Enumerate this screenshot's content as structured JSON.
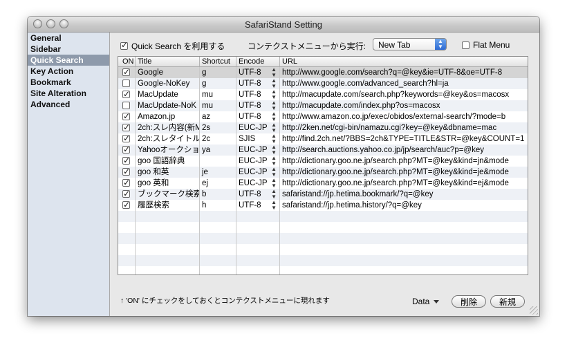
{
  "window": {
    "title": "SafariStand Setting"
  },
  "sidebar": {
    "items": [
      {
        "label": "General",
        "selected": false
      },
      {
        "label": "Sidebar",
        "selected": false
      },
      {
        "label": "Quick Search",
        "selected": true
      },
      {
        "label": "Key Action",
        "selected": false
      },
      {
        "label": "Bookmark",
        "selected": false
      },
      {
        "label": "Site Alteration",
        "selected": false
      },
      {
        "label": "Advanced",
        "selected": false
      }
    ]
  },
  "options": {
    "quick_search_label": "Quick Search を利用する",
    "quick_search_checked": true,
    "context_label": "コンテクストメニューから実行:",
    "context_value": "New Tab",
    "flat_menu_label": "Flat Menu",
    "flat_menu_checked": false
  },
  "table": {
    "headers": {
      "on": "ON",
      "title": "Title",
      "shortcut": "Shortcut",
      "encode": "Encode",
      "url": "URL"
    },
    "rows": [
      {
        "on": true,
        "title": "Google",
        "shortcut": "g",
        "encode": "UTF-8",
        "url": "http://www.google.com/search?q=@key&ie=UTF-8&oe=UTF-8",
        "selected": true
      },
      {
        "on": false,
        "title": "Google-NoKey",
        "shortcut": "g",
        "encode": "UTF-8",
        "url": "http://www.google.com/advanced_search?hl=ja"
      },
      {
        "on": true,
        "title": "MacUpdate",
        "shortcut": "mu",
        "encode": "UTF-8",
        "url": "http://macupdate.com/search.php?keywords=@key&os=macosx"
      },
      {
        "on": false,
        "title": "MacUpdate-NoK",
        "shortcut": "mu",
        "encode": "UTF-8",
        "url": "http://macupdate.com/index.php?os=macosx"
      },
      {
        "on": true,
        "title": "Amazon.jp",
        "shortcut": "az",
        "encode": "UTF-8",
        "url": "http://www.amazon.co.jp/exec/obidos/external-search/?mode=b"
      },
      {
        "on": true,
        "title": "2ch:スレ内容(新M",
        "shortcut": "2s",
        "encode": "EUC-JP",
        "url": "http://2ken.net/cgi-bin/namazu.cgi?key=@key&dbname=mac"
      },
      {
        "on": true,
        "title": "2ch:スレタイトル",
        "shortcut": "2c",
        "encode": "SJIS",
        "url": "http://find.2ch.net/?BBS=2ch&TYPE=TITLE&STR=@key&COUNT=1"
      },
      {
        "on": true,
        "title": "Yahooオークショ",
        "shortcut": "ya",
        "encode": "EUC-JP",
        "url": "http://search.auctions.yahoo.co.jp/jp/search/auc?p=@key"
      },
      {
        "on": true,
        "title": "goo 国語辞典",
        "shortcut": "",
        "encode": "EUC-JP",
        "url": "http://dictionary.goo.ne.jp/search.php?MT=@key&kind=jn&mode"
      },
      {
        "on": true,
        "title": "goo 和英",
        "shortcut": "je",
        "encode": "EUC-JP",
        "url": "http://dictionary.goo.ne.jp/search.php?MT=@key&kind=je&mode"
      },
      {
        "on": true,
        "title": "goo 英和",
        "shortcut": "ej",
        "encode": "EUC-JP",
        "url": "http://dictionary.goo.ne.jp/search.php?MT=@key&kind=ej&mode"
      },
      {
        "on": true,
        "title": "ブックマーク検索",
        "shortcut": "b",
        "encode": "UTF-8",
        "url": "safaristand://jp.hetima.bookmark/?q=@key"
      },
      {
        "on": true,
        "title": "履歴検索",
        "shortcut": "h",
        "encode": "UTF-8",
        "url": "safaristand://jp.hetima.history/?q=@key"
      }
    ],
    "empty_rows": 6
  },
  "footer": {
    "hint": "↑ 'ON' にチェックをしておくとコンテクストメニューに現れます",
    "data_menu_label": "Data",
    "delete_label": "削除",
    "new_label": "新規"
  }
}
